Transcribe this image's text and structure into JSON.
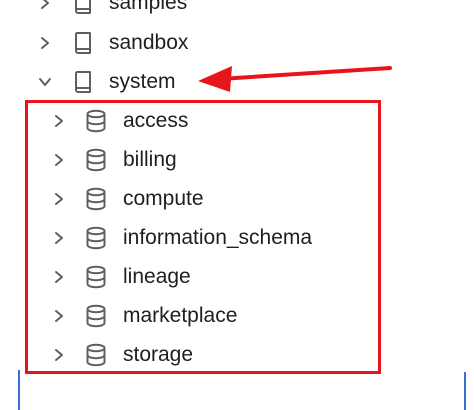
{
  "tree": {
    "catalogs": [
      {
        "label": "samples",
        "expanded": false,
        "icon": "catalog-book-icon"
      },
      {
        "label": "sandbox",
        "expanded": false,
        "icon": "catalog-book-icon"
      },
      {
        "label": "system",
        "expanded": true,
        "icon": "catalog-book-icon"
      }
    ],
    "schemas": [
      {
        "label": "access",
        "icon": "database-icon"
      },
      {
        "label": "billing",
        "icon": "database-icon"
      },
      {
        "label": "compute",
        "icon": "database-icon"
      },
      {
        "label": "information_schema",
        "icon": "database-icon"
      },
      {
        "label": "lineage",
        "icon": "database-icon"
      },
      {
        "label": "marketplace",
        "icon": "database-icon"
      },
      {
        "label": "storage",
        "icon": "database-icon"
      }
    ]
  },
  "annotation": {
    "box_color": "#e8141c",
    "arrow_color": "#e8141c"
  },
  "colors": {
    "text": "#1f1f1f",
    "icon": "#5f5f5f",
    "accent_edge": "#3b6fd8"
  }
}
